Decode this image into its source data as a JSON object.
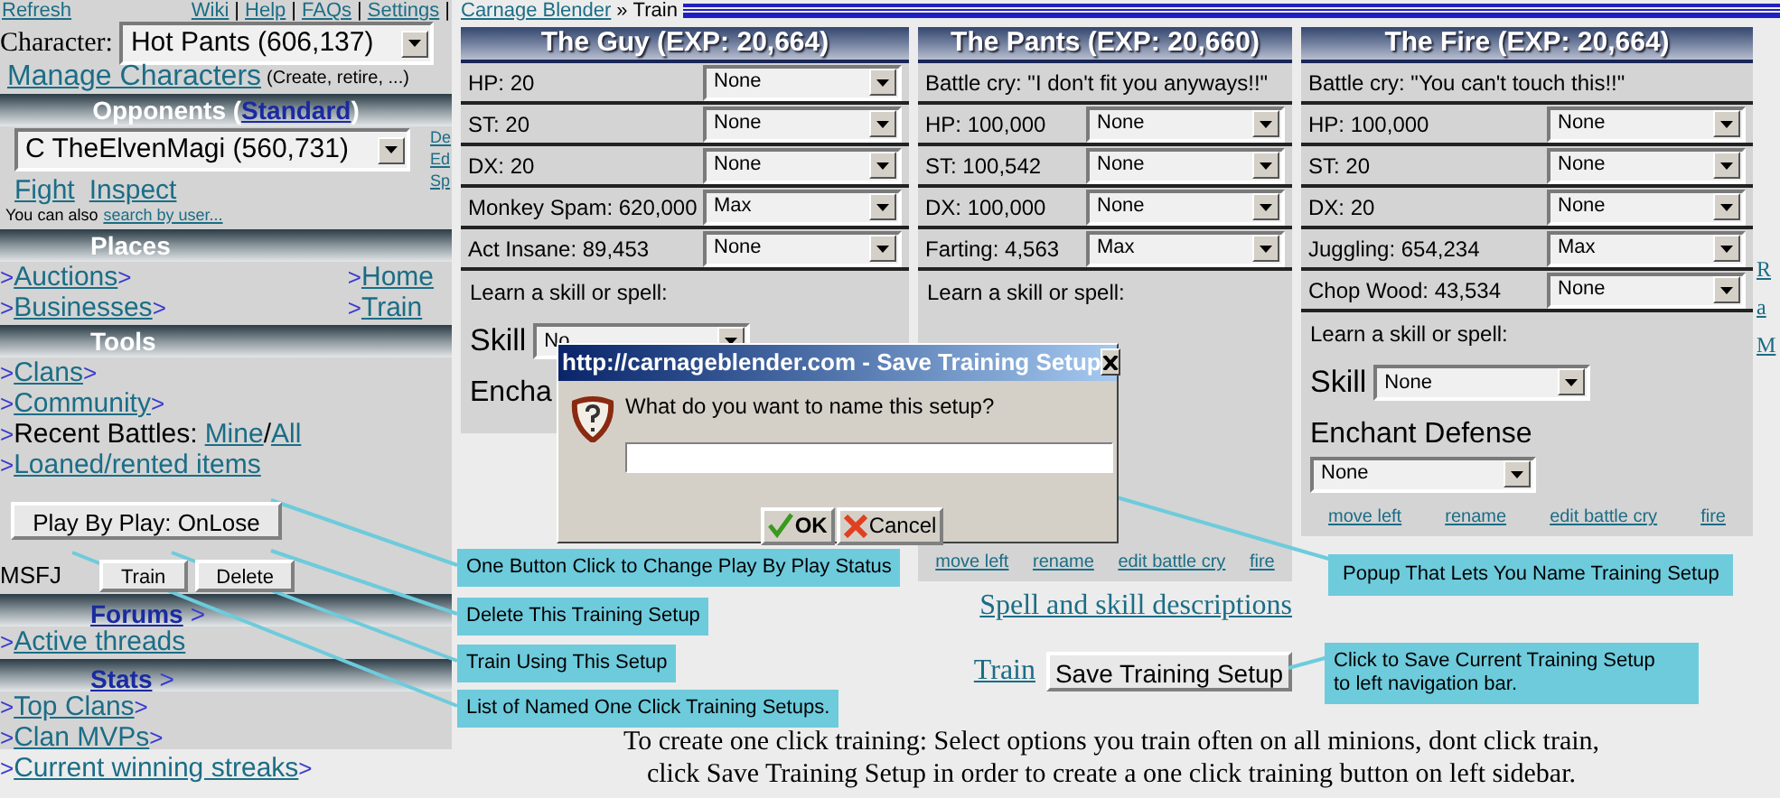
{
  "sidebar": {
    "top_left_link": "Refresh",
    "top_links": [
      "Wiki",
      "Help",
      "FAQs",
      "Settings"
    ],
    "separator": "|",
    "character": {
      "label": "Character:",
      "value": "Hot Pants (606,137)"
    },
    "manage": {
      "link": "Manage Characters",
      "note": "(Create, retire, ...)"
    },
    "opponents": {
      "before": "Opponents (",
      "link": "Standard",
      "after": ")"
    },
    "opponent_select": "C TheElvenMagi (560,731)",
    "side_fragments": [
      "De",
      "Ed",
      "Sp"
    ],
    "opponent_links": [
      "Fight",
      "Inspect"
    ],
    "search": {
      "text": "You can also",
      "link": "search by user..."
    },
    "sections": [
      {
        "title": "Places",
        "title_is_link": false,
        "items": [
          {
            "pre": ">",
            "label": "Auctions",
            "post": ">"
          },
          {
            "pre": ">",
            "label": "Businesses",
            "post": ">"
          }
        ],
        "right_items": [
          {
            "pre": ">",
            "label": "Home"
          },
          {
            "pre": ">",
            "label": "Train"
          }
        ]
      },
      {
        "title": "Tools",
        "title_is_link": false,
        "items": [
          {
            "pre": ">",
            "label": "Clans",
            "post": ">"
          },
          {
            "pre": ">",
            "label": "Community",
            "post": ">"
          },
          {
            "kind": "battles",
            "pre": ">",
            "text": "Recent Battles:",
            "links": [
              "Mine",
              "All"
            ],
            "sep": "/"
          },
          {
            "pre": ">",
            "label": "Loaned/rented items"
          }
        ]
      },
      {
        "title": "Forums",
        "title_is_link": true,
        "title_post": ">",
        "items": [
          {
            "pre": ">",
            "label": "Active threads"
          }
        ]
      },
      {
        "title": "Stats",
        "title_is_link": true,
        "title_post": ">",
        "items": [
          {
            "pre": ">",
            "label": "Top Clans",
            "post": ">"
          },
          {
            "pre": ">",
            "label": "Clan MVPs",
            "post": ">"
          },
          {
            "pre": ">",
            "label": "Current winning streaks",
            "post": ">"
          }
        ]
      }
    ],
    "play_by_play": "Play By Play: OnLose",
    "setups": [
      {
        "name": "MSFJ",
        "buttons": [
          "Train",
          "Delete"
        ]
      }
    ]
  },
  "breadcrumb": {
    "link": "Carnage Blender",
    "separator": "»",
    "current": "Train"
  },
  "minions": [
    {
      "title": "The Guy (EXP: 20,664)",
      "rows": [
        {
          "kind": "stat",
          "label": "HP: 20",
          "value": "None"
        },
        {
          "kind": "stat",
          "label": "ST: 20",
          "value": "None"
        },
        {
          "kind": "stat",
          "label": "DX: 20",
          "value": "None"
        },
        {
          "kind": "stat",
          "label": "Monkey Spam: 620,000",
          "value": "Max"
        },
        {
          "kind": "stat",
          "label": "Act Insane: 89,453",
          "value": "None"
        }
      ],
      "learn": "Learn a skill or spell:",
      "skill_label": "Skill",
      "skill_value": "No",
      "enchant_label": "Encha"
    },
    {
      "title": "The Pants (EXP: 20,660)",
      "rows": [
        {
          "kind": "cry",
          "text": "Battle cry: \"I don't fit you anyways!!\""
        },
        {
          "kind": "stat",
          "label": "HP: 100,000",
          "value": "None"
        },
        {
          "kind": "stat",
          "label": "ST: 100,542",
          "value": "None"
        },
        {
          "kind": "stat",
          "label": "DX: 100,000",
          "value": "None"
        },
        {
          "kind": "stat",
          "label": "Farting: 4,563",
          "value": "Max"
        }
      ],
      "learn": "Learn a skill or spell:",
      "links": [
        "move left",
        "rename",
        "edit battle cry",
        "fire"
      ]
    },
    {
      "title": "The Fire (EXP: 20,664)",
      "rows": [
        {
          "kind": "cry",
          "text": "Battle cry: \"You can't touch this!!\""
        },
        {
          "kind": "stat",
          "label": "HP: 100,000",
          "value": "None"
        },
        {
          "kind": "stat",
          "label": "ST: 20",
          "value": "None"
        },
        {
          "kind": "stat",
          "label": "DX: 20",
          "value": "None"
        },
        {
          "kind": "stat",
          "label": "Juggling: 654,234",
          "value": "Max"
        },
        {
          "kind": "stat",
          "label": "Chop Wood: 43,534",
          "value": "None"
        }
      ],
      "learn": "Learn a skill or spell:",
      "skill_label": "Skill",
      "skill_value": "None",
      "enchant_label": "Enchant Defense",
      "enchant_value": "None",
      "links": [
        "move left",
        "rename",
        "edit battle cry",
        "fire"
      ]
    }
  ],
  "right_fragments": [
    "R",
    "a",
    "M"
  ],
  "descriptions_link": "Spell and skill descriptions",
  "train_link": "Train",
  "save_button": "Save Training Setup",
  "instructions": "To create one click training: Select options you train often on all minions, dont click train,\nclick Save Training Setup in order to create a one click training button on left sidebar.",
  "dialog": {
    "title": "http://carnageblender.com - Save Training Setup",
    "prompt": "What do you want to name this setup?",
    "buttons": [
      {
        "kind": "ok",
        "label": "OK"
      },
      {
        "kind": "cancel",
        "label": "Cancel"
      }
    ]
  },
  "callouts": [
    {
      "text": "One Button Click to Change Play By Play Status"
    },
    {
      "text": "Delete This Training Setup"
    },
    {
      "text": "Train Using This Setup"
    },
    {
      "text": "List of Named One Click Training Setups."
    },
    {
      "text": "Popup That Lets You Name Training Setup"
    },
    {
      "text": "Click to Save Current Training Setup\nto left navigation bar."
    }
  ]
}
